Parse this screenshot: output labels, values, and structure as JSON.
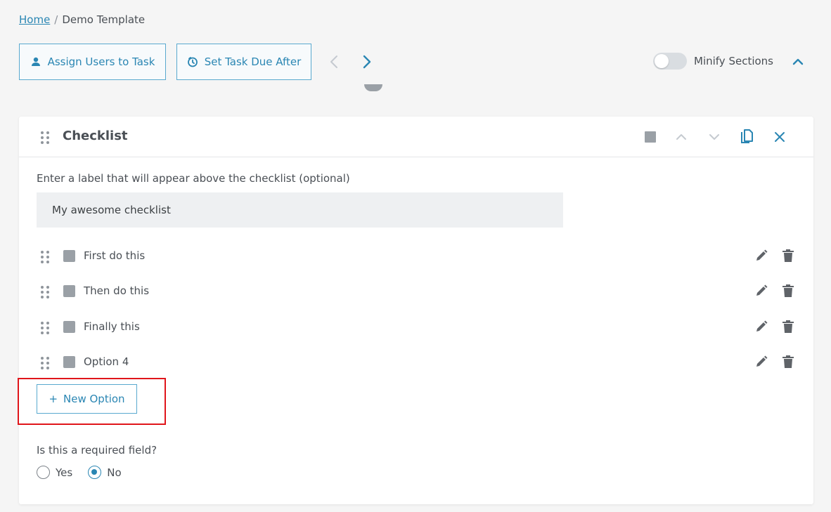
{
  "breadcrumb": {
    "home": "Home",
    "separator": "/",
    "current": "Demo Template"
  },
  "toolbar": {
    "assign_label": "Assign Users to Task",
    "due_label": "Set Task Due After",
    "minify_label": "Minify Sections",
    "minify_on": false
  },
  "card": {
    "title": "Checklist",
    "label_prompt": "Enter a label that will appear above the checklist (optional)",
    "label_value": "My awesome checklist",
    "options": [
      {
        "label": "First do this"
      },
      {
        "label": "Then do this"
      },
      {
        "label": "Finally this"
      },
      {
        "label": "Option 4"
      }
    ],
    "new_option_label": "New Option",
    "new_option_plus": "+",
    "required_prompt": "Is this a required field?",
    "required_choices": [
      "Yes",
      "No"
    ],
    "required_selected": "No"
  },
  "colors": {
    "accent": "#2a86b3",
    "highlight": "#e0151b",
    "background": "#f5f5f5"
  }
}
